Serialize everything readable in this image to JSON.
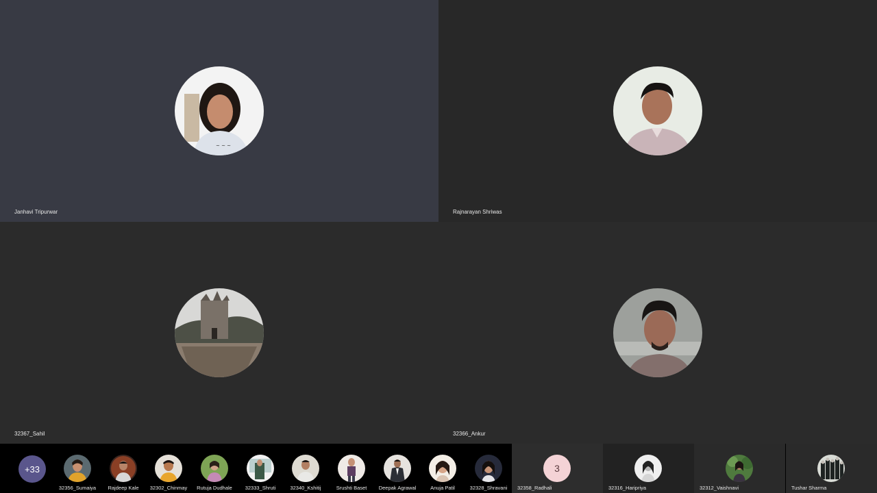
{
  "main_tiles": [
    {
      "name": "Janhavi Tripurwar",
      "bg": "#383a44"
    },
    {
      "name": "Rajnarayan Shriwas",
      "bg": "#282828"
    },
    {
      "name": "32367_Sahil",
      "bg": "#2b2b2b"
    },
    {
      "name": "32366_Ankur",
      "bg": "#2b2b2b"
    }
  ],
  "overflow_count": "+33",
  "strip_thumbs": [
    {
      "name": "32356_Sumaiya"
    },
    {
      "name": "Rajdeep Kale"
    },
    {
      "name": "32302_Chinmay"
    },
    {
      "name": "Rutuja Dudhale"
    },
    {
      "name": "32333_Shruti"
    },
    {
      "name": "32340_Kshitij"
    },
    {
      "name": "Srushti Baset"
    },
    {
      "name": "Deepak Agrawal"
    },
    {
      "name": "Anuja Patil"
    },
    {
      "name": "32328_Shravani"
    }
  ],
  "strip_tiles": [
    {
      "name": "32358_Radhali",
      "initial": "3",
      "bg": "#2d2d2d"
    },
    {
      "name": "32316_Haripriya",
      "bg": "#222222"
    },
    {
      "name": "32312_Vaishnavi",
      "bg": "#2a2a2a"
    },
    {
      "name": "Tushar Sharma",
      "bg": "#2a2a2a"
    }
  ],
  "colors": {
    "accent_more": "#5a568c",
    "initial_avatar_bg": "#f4d3d6"
  },
  "icons": [
    "participant-avatar-photo"
  ]
}
